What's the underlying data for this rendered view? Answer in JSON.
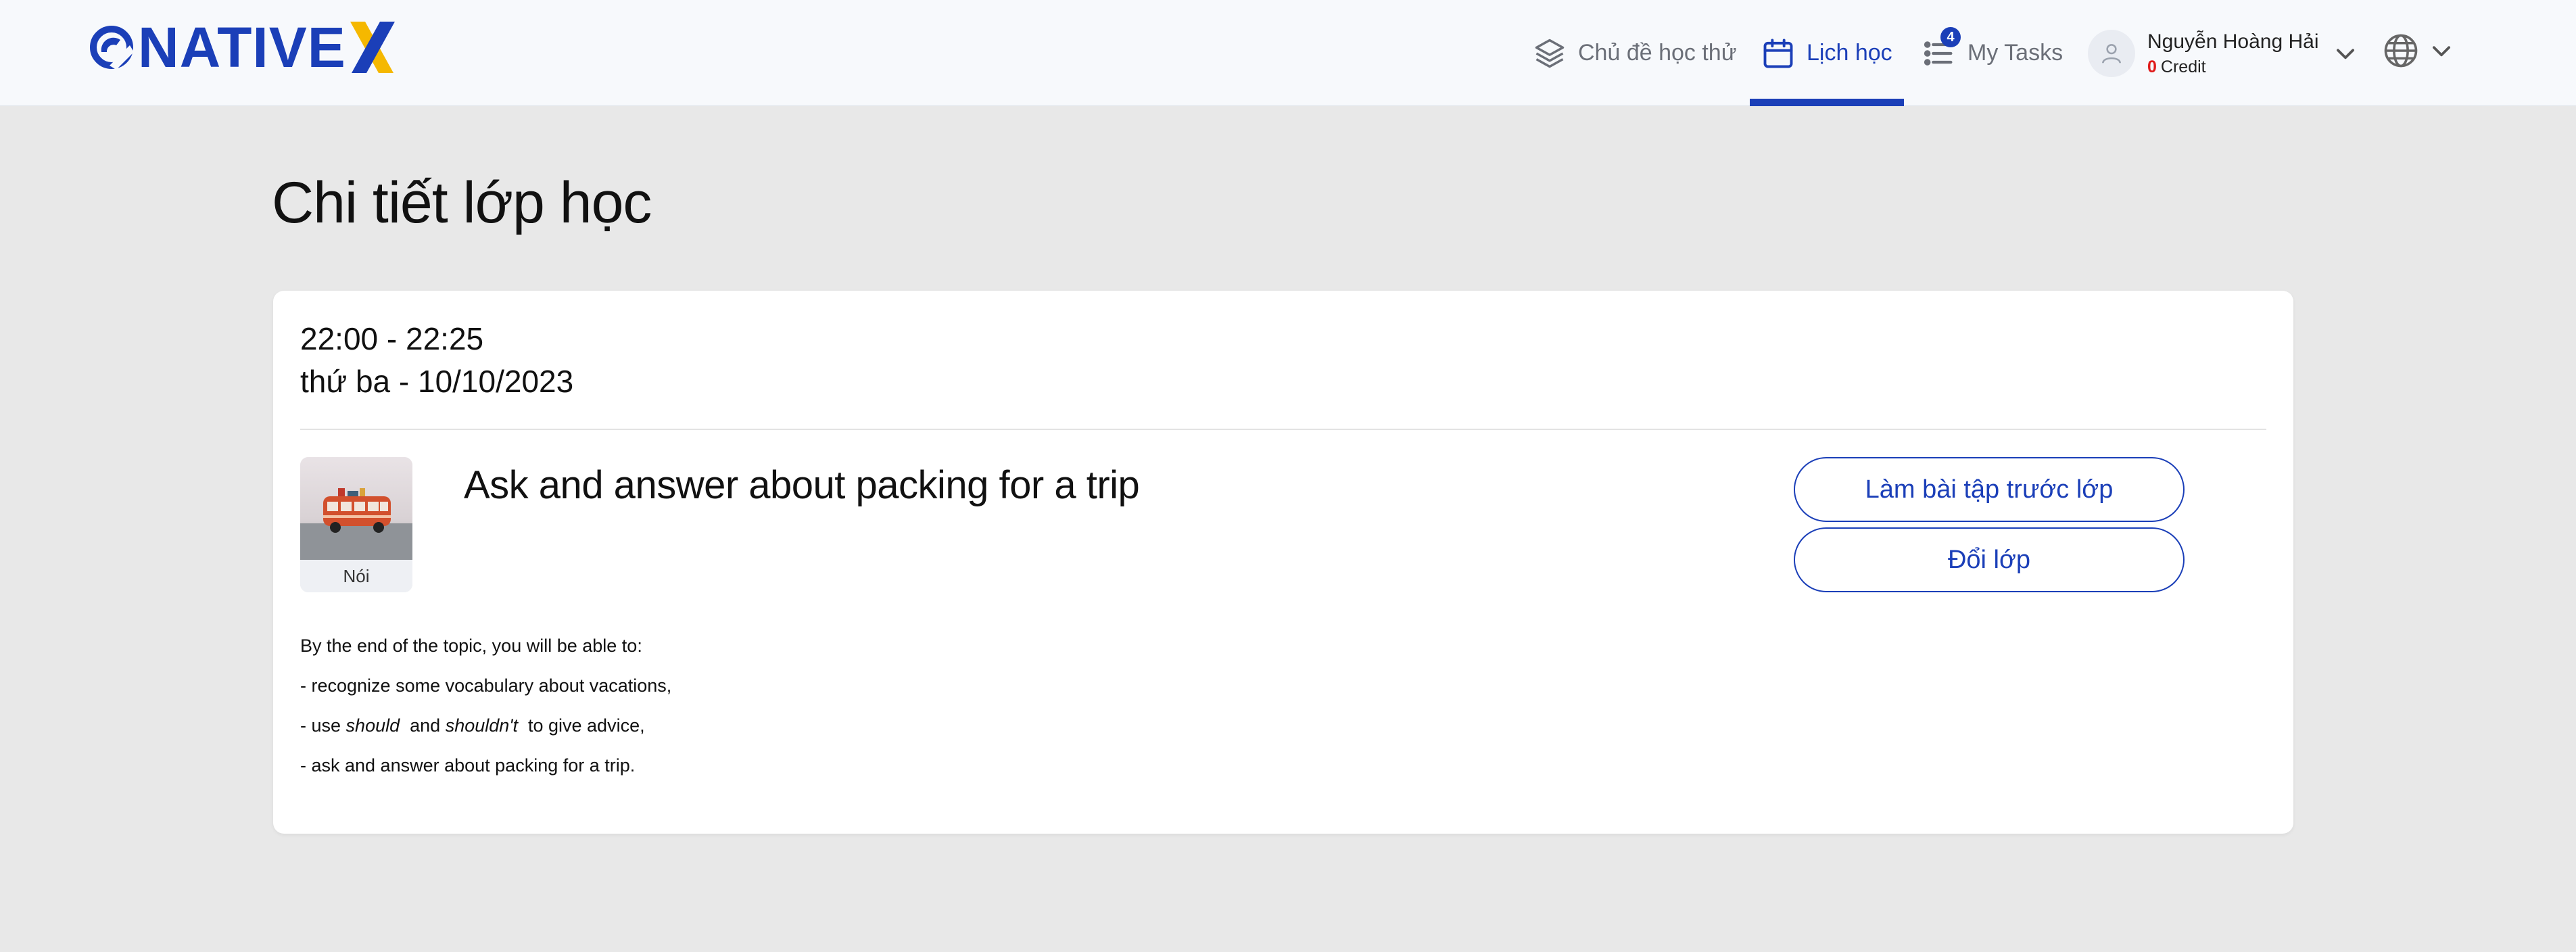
{
  "header": {
    "logo_text": "NATIVE",
    "nav": {
      "topics_label": "Chủ đề học thử",
      "schedule_label": "Lịch học",
      "tasks_label": "My Tasks",
      "tasks_badge": "4"
    },
    "user": {
      "name": "Nguyễn Hoàng Hải",
      "credit_value": "0",
      "credit_label": "Credit"
    },
    "colors": {
      "brand": "#1b3fb8",
      "accent": "#f5b800",
      "credit": "#e01b1b"
    }
  },
  "page": {
    "title": "Chi tiết lớp học"
  },
  "class": {
    "time": "22:00 - 22:25",
    "date": "thứ ba - 10/10/2023",
    "topic_title": "Ask and answer about packing for a trip",
    "skill_label": "Nói",
    "buttons": {
      "homework": "Làm bài tập trước lớp",
      "change_class": "Đổi lớp"
    },
    "description": {
      "intro": "By the end of the topic, you will be able to:",
      "line1": "- recognize some vocabulary about vacations,",
      "line2_prefix": "- use",
      "line2_word1": "should",
      "line2_and": "and",
      "line2_word2": "shouldn't",
      "line2_suffix": "to give advice,",
      "line3": "- ask and answer about packing for a trip."
    }
  }
}
